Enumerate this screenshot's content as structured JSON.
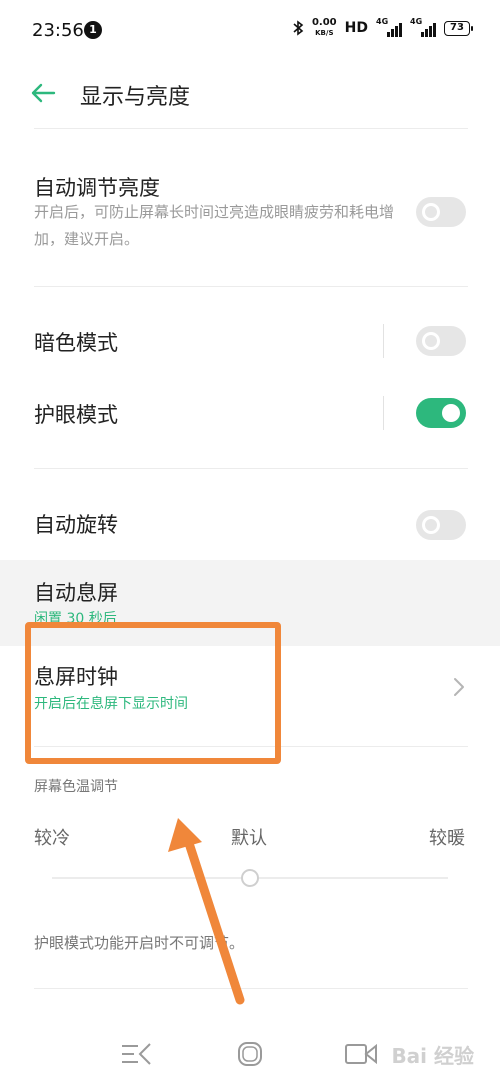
{
  "status_bar": {
    "time": "23:56",
    "notification_count": "1",
    "net_speed_value": "0.00",
    "net_speed_unit": "KB/S",
    "hd_label": "HD",
    "signal1_label": "4G",
    "signal2_label": "4G",
    "battery": "73"
  },
  "header": {
    "title": "显示与亮度"
  },
  "settings": {
    "auto_brightness": {
      "title": "自动调节亮度",
      "description": "开启后，可防止屏幕长时间过亮造成眼睛疲劳和耗电增加，建议开启。",
      "enabled": false
    },
    "dark_mode": {
      "title": "暗色模式",
      "enabled": false
    },
    "eye_care": {
      "title": "护眼模式",
      "enabled": true
    },
    "auto_rotate": {
      "title": "自动旋转",
      "enabled": false
    },
    "auto_sleep": {
      "title": "自动息屏",
      "value": "闲置 30 秒后"
    },
    "aod_clock": {
      "title": "息屏时钟",
      "subtitle": "开启后在息屏下显示时间"
    }
  },
  "color_temp": {
    "section_label": "屏幕色温调节",
    "cool_label": "较冷",
    "default_label": "默认",
    "warm_label": "较暖",
    "slider_position": 0.5,
    "note": "护眼模式功能开启时不可调节。"
  },
  "watermark": "Bai 经验",
  "colors": {
    "accent": "#2db87d",
    "annotation": "#f0873a"
  }
}
